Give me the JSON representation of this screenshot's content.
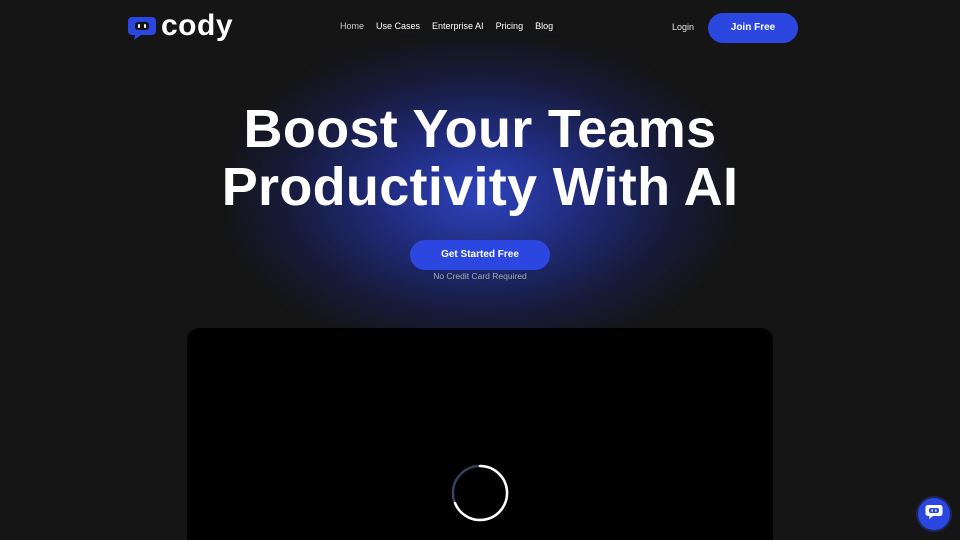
{
  "brand": {
    "name": "cody",
    "accent": "#2b47e0"
  },
  "nav": {
    "items": [
      {
        "label": "Home"
      },
      {
        "label": "Use Cases"
      },
      {
        "label": "Enterprise AI"
      },
      {
        "label": "Pricing"
      },
      {
        "label": "Blog"
      }
    ],
    "login_label": "Login",
    "join_label": "Join Free"
  },
  "hero": {
    "title_line1": "Boost Your Teams",
    "title_line2": "Productivity With AI",
    "cta_label": "Get Started Free",
    "cta_note": "No Credit Card Required"
  },
  "video": {
    "state": "loading",
    "spinner_icon": "loading-spinner-icon"
  },
  "chat_widget": {
    "icon": "chat-bot-icon"
  }
}
